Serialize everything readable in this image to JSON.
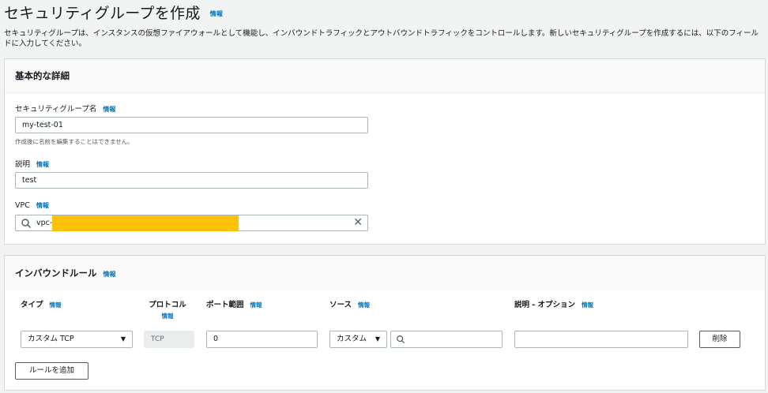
{
  "page": {
    "title": "セキュリティグループを作成",
    "info": "情報",
    "description": "セキュリティグループは、インスタンスの仮想ファイアウォールとして機能し、インバウンドトラフィックとアウトバウンドトラフィックをコントロールします。新しいセキュリティグループを作成するには、以下のフィールドに入力してください。"
  },
  "basic": {
    "header": "基本的な詳細",
    "name_label": "セキュリティグループ名",
    "name_info": "情報",
    "name_value": "my-test-01",
    "name_hint": "作成後に名前を編集することはできません。",
    "desc_label": "説明",
    "desc_info": "情報",
    "desc_value": "test",
    "vpc_label": "VPC",
    "vpc_info": "情報",
    "vpc_value": "vpc-",
    "vpc_clear": "✕"
  },
  "inbound": {
    "header": "インバウンドルール",
    "header_info": "情報",
    "columns": {
      "type": "タイプ",
      "type_info": "情報",
      "protocol": "プロトコル",
      "protocol_info": "情報",
      "port": "ポート範囲",
      "port_info": "情報",
      "source": "ソース",
      "source_info": "情報",
      "desc": "説明 - オプション",
      "desc_info": "情報"
    },
    "row": {
      "type": "カスタム TCP",
      "protocol": "TCP",
      "port": "0",
      "source_type": "カスタム",
      "source_search": "",
      "desc": "",
      "delete": "削除"
    },
    "add_rule": "ルールを追加"
  },
  "colors": {
    "link": "#0073bb",
    "redaction": "#ffc10a",
    "background": "#f2f3f3"
  }
}
